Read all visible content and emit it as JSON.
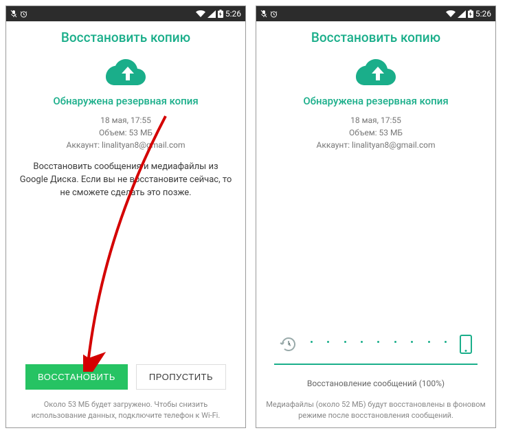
{
  "statusbar": {
    "time": "5:26"
  },
  "left": {
    "title": "Восстановить копию",
    "subtitle": "Обнаружена резервная копия",
    "meta_date": "18 мая, 17:55",
    "meta_size": "Объем: 53 МБ",
    "meta_account": "Аккаунт: linalityan8@gmail.com",
    "description": "Восстановить сообщения и медиафайлы из Google Диска. Если вы не восстановите сейчас, то не сможете сделать это позже.",
    "btn_restore": "ВОССТАНОВИТЬ",
    "btn_skip": "ПРОПУСТИТЬ",
    "footer": "Около 53 МБ будет загружено. Чтобы снизить использование данных, подключите телефон к Wi-Fi."
  },
  "right": {
    "title": "Восстановить копию",
    "subtitle": "Обнаружена резервная копия",
    "meta_date": "18 мая, 17:55",
    "meta_size": "Объем: 53 МБ",
    "meta_account": "Аккаунт: linalityan8@gmail.com",
    "progress_text": "Восстановление сообщений (100%)",
    "footer": "Медиафайлы (около 52 МБ) будут восстановлены в фоновом режиме после восстановления сообщений."
  }
}
